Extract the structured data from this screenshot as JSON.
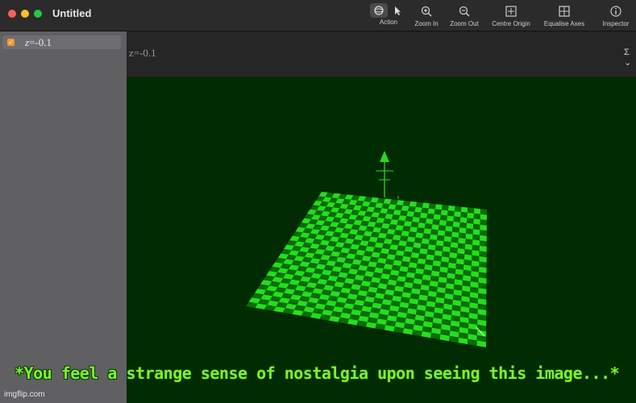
{
  "window": {
    "title": "Untitled"
  },
  "toolbar": {
    "items": [
      {
        "label": "Action",
        "icon": "action-icon"
      },
      {
        "label": "Zoom In",
        "icon": "zoom-in-icon"
      },
      {
        "label": "Zoom Out",
        "icon": "zoom-out-icon"
      },
      {
        "label": "Centre Origin",
        "icon": "centre-origin-icon"
      },
      {
        "label": "Equalise Axes",
        "icon": "equalise-axes-icon"
      },
      {
        "label": "Inspector",
        "icon": "inspector-icon"
      }
    ],
    "modes": [
      "rotate-mode-icon",
      "pointer-mode-icon"
    ]
  },
  "sidebar": {
    "equations": [
      {
        "var": "z",
        "expr": "=-0.1",
        "checked": true,
        "color": "#f39a2a"
      }
    ]
  },
  "view": {
    "header_eq": "z=-0.1",
    "sigma": "Σ ⌄",
    "background": "#012b00",
    "plane_colors": [
      "#22e01b",
      "#0d6a0a"
    ],
    "axis_color": "#2fd42a"
  },
  "caption": "*You feel a strange sense of nostalgia upon seeing this image...*",
  "watermark": "imgflip.com"
}
